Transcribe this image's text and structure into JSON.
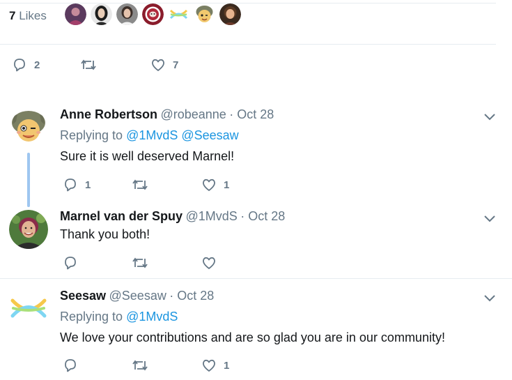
{
  "likes": {
    "count": "7",
    "label": " Likes",
    "avatars": [
      "avatar-purple",
      "avatar-dark",
      "avatar-gray",
      "avatar-red-logo",
      "avatar-seesaw",
      "avatar-cartoon",
      "avatar-brown"
    ]
  },
  "main_actions": {
    "replies": "2",
    "retweets": "",
    "likes": "7"
  },
  "tweets": [
    {
      "name": "Anne Robertson",
      "handle": "@robeanne",
      "date": "· Oct 28",
      "replying_prefix": "Replying to ",
      "mention1": "@1MvdS",
      "mention2": " @Seesaw",
      "text": "Sure it is well deserved Marnel!",
      "reply_count": "1",
      "like_count": "1"
    },
    {
      "name": "Marnel van der Spuy",
      "handle": "@1MvdS",
      "date": "· Oct 28",
      "text": "Thank you both!",
      "reply_count": "",
      "like_count": ""
    },
    {
      "name": "Seesaw",
      "handle": "@Seesaw",
      "date": "· Oct 28",
      "replying_prefix": "Replying to ",
      "mention1": "@1MvdS",
      "text": "We love your contributions and are so glad you are in our community!",
      "reply_count": "",
      "like_count": "1"
    }
  ],
  "colors": {
    "accent": "#1b95e0",
    "muted": "#657786",
    "thread_line": "#9ec6f0",
    "divider": "#e6ecf0"
  }
}
